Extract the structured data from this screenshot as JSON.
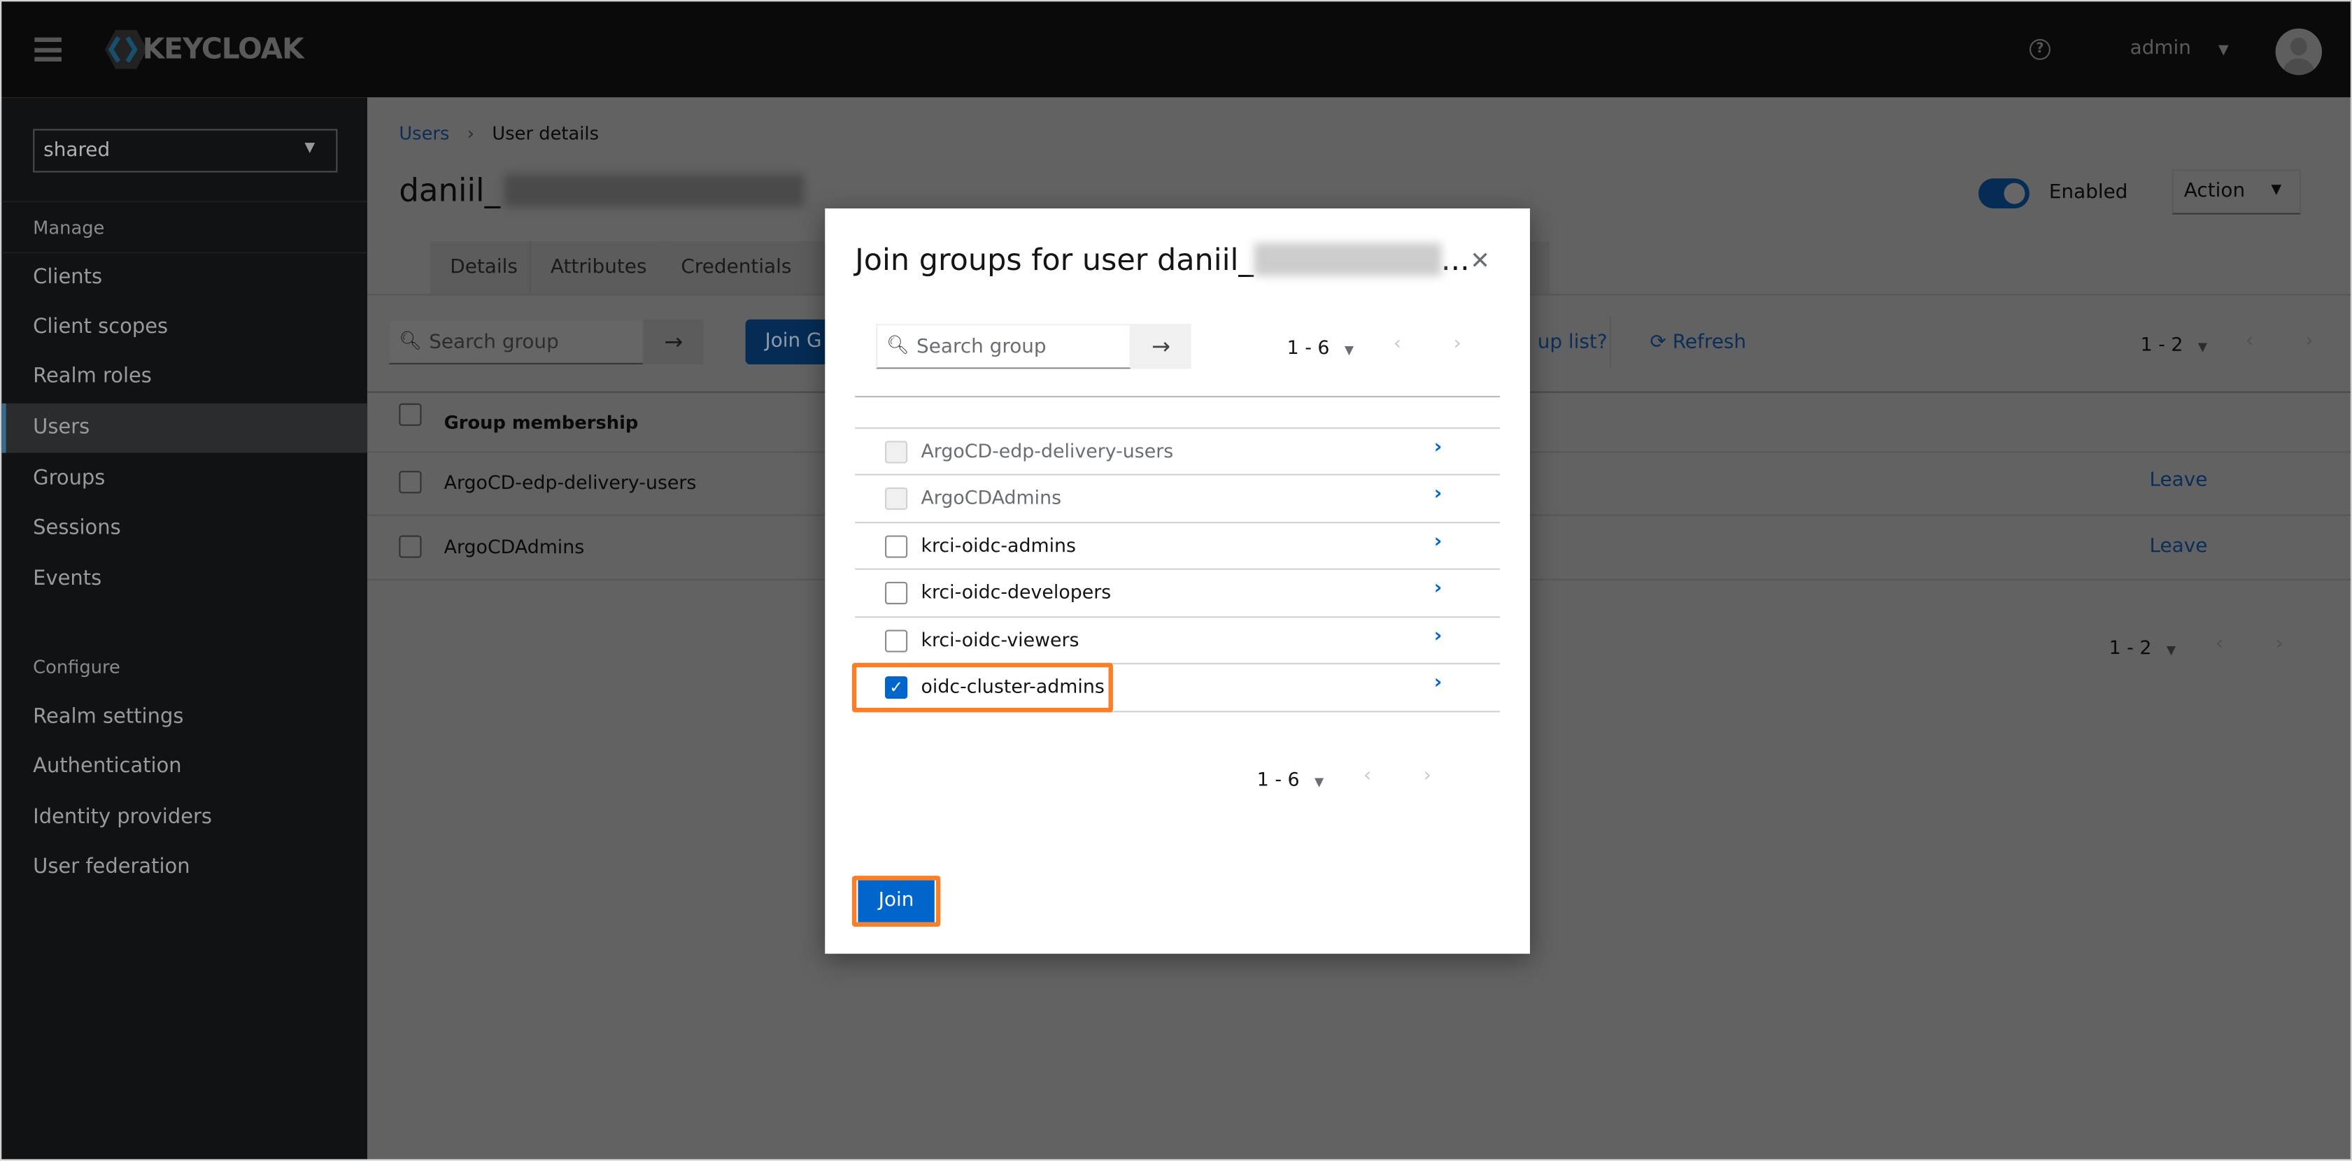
{
  "header": {
    "brand": "KEYCLOAK",
    "user": "admin"
  },
  "sidebar": {
    "realm": "shared",
    "manage_label": "Manage",
    "manage_items": [
      {
        "label": "Clients"
      },
      {
        "label": "Client scopes"
      },
      {
        "label": "Realm roles"
      },
      {
        "label": "Users",
        "active": true
      },
      {
        "label": "Groups"
      },
      {
        "label": "Sessions"
      },
      {
        "label": "Events"
      }
    ],
    "configure_label": "Configure",
    "configure_items": [
      {
        "label": "Realm settings"
      },
      {
        "label": "Authentication"
      },
      {
        "label": "Identity providers"
      },
      {
        "label": "User federation"
      }
    ]
  },
  "main": {
    "breadcrumb": {
      "parent": "Users",
      "current": "User details"
    },
    "title": "daniil_",
    "enabled_label": "Enabled",
    "enabled": true,
    "action_label": "Action",
    "tabs": [
      "Details",
      "Attributes",
      "Credentials"
    ],
    "toolbar": {
      "search_placeholder": "Search group",
      "join_button": "Join G",
      "partial_link": "up list?",
      "refresh": "Refresh",
      "pagination": "1 - 2"
    },
    "table": {
      "header": "Group membership",
      "rows": [
        {
          "name": "ArgoCD-edp-delivery-users",
          "action": "Leave"
        },
        {
          "name": "ArgoCDAdmins",
          "action": "Leave"
        }
      ]
    },
    "bottom_pagination": "1 - 2"
  },
  "modal": {
    "title": "Join groups for user daniil_",
    "title_ellipsis": "...",
    "search_placeholder": "Search group",
    "pagination": "1 - 6",
    "groups": [
      {
        "name": "ArgoCD-edp-delivery-users",
        "disabled": true,
        "checked": false
      },
      {
        "name": "ArgoCDAdmins",
        "disabled": true,
        "checked": false
      },
      {
        "name": "krci-oidc-admins",
        "disabled": false,
        "checked": false
      },
      {
        "name": "krci-oidc-developers",
        "disabled": false,
        "checked": false
      },
      {
        "name": "krci-oidc-viewers",
        "disabled": false,
        "checked": false
      },
      {
        "name": "oidc-cluster-admins",
        "disabled": false,
        "checked": true
      }
    ],
    "bottom_pagination": "1 - 6",
    "join_button": "Join"
  },
  "colors": {
    "primary": "#0066cc",
    "highlight": "#fa7f2a",
    "header": "#151515",
    "sidebar": "#212427"
  }
}
